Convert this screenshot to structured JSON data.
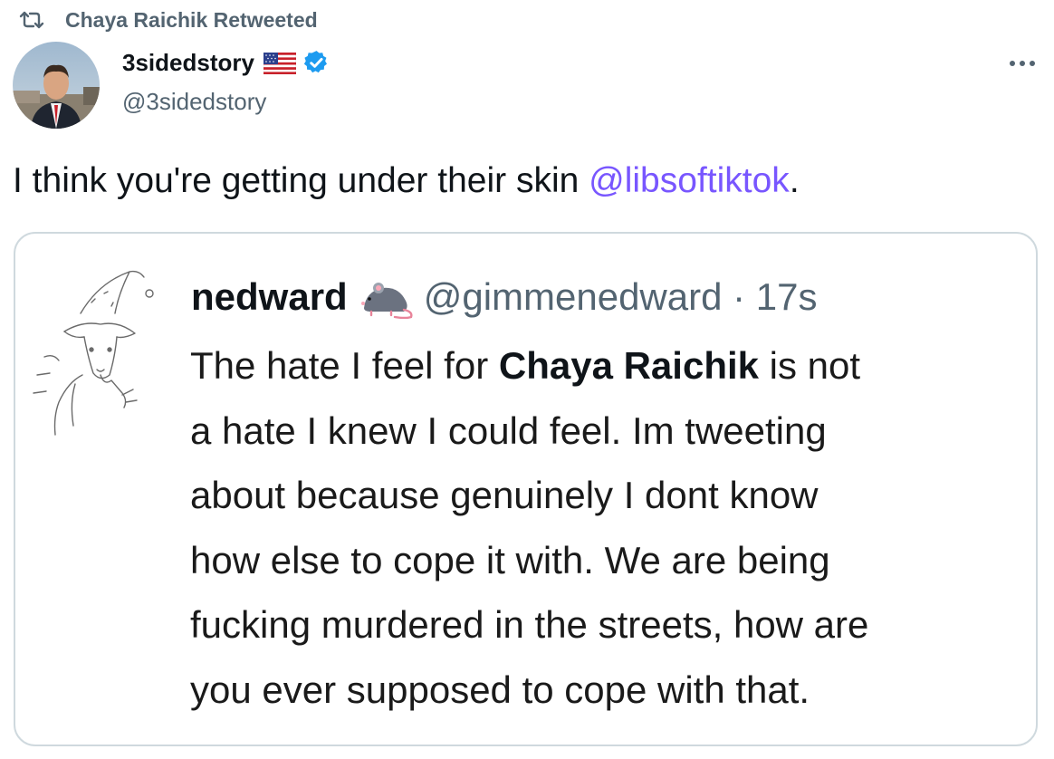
{
  "retweet": {
    "label": "Chaya Raichik Retweeted"
  },
  "author": {
    "name": "3sidedstory",
    "handle": "@3sidedstory"
  },
  "tweet": {
    "text_before": "I think you're getting under their skin ",
    "mention": "@libsoftiktok",
    "text_after": "."
  },
  "quote": {
    "name": "nedward",
    "handle_time": "@gimmenedward · 17s",
    "lines": [
      {
        "before": "The hate I feel for ",
        "bold": "Chaya Raichik",
        "after": " is not"
      },
      {
        "text": "a hate I knew I could feel. Im tweeting"
      },
      {
        "text": "about because genuinely I dont know"
      },
      {
        "text": "how else to cope it with. We are being"
      },
      {
        "text": "fucking murdered in the streets, how are"
      },
      {
        "text": "you ever supposed to cope with that."
      }
    ]
  },
  "colors": {
    "mention": "#7856ff",
    "secondary_text": "#536471",
    "verified": "#1d9bf0",
    "border": "#cfd9de"
  },
  "icons": [
    "retweet-icon",
    "us-flag-icon",
    "verified-badge-icon",
    "more-options-icon",
    "rat-emoji-icon"
  ]
}
